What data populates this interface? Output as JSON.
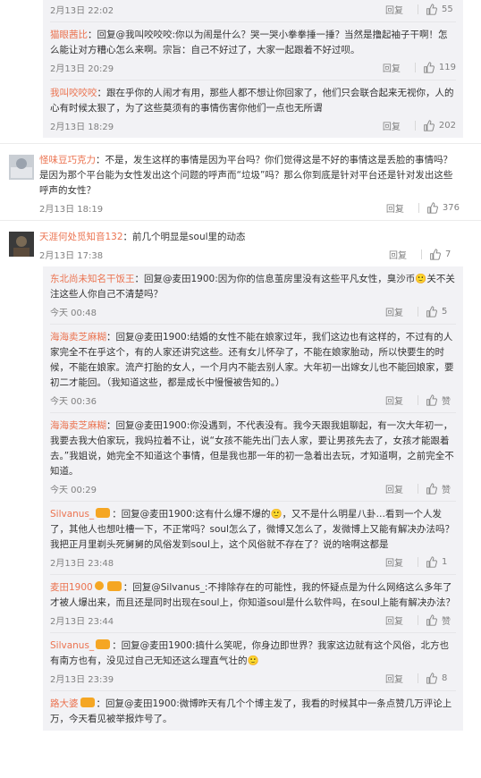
{
  "comments": [
    {
      "kind": "sub",
      "user": "",
      "body": "",
      "time": "2月13日 22:02",
      "reply": "回复",
      "likes": "55"
    },
    {
      "kind": "sub",
      "user": "猫眼茜比",
      "body": "：回复@我叫咬咬咬:你以为闹是什么？哭一哭小拳拳捶一捶？当然是撸起袖子干啊！怎么能让对方糟心怎么来啊。宗旨：自己不好过了，大家一起跟着不好过呗。",
      "time": "2月13日 20:29",
      "reply": "回复",
      "likes": "119"
    },
    {
      "kind": "sub",
      "user": "我叫咬咬咬",
      "body": "：跟在乎你的人闹才有用，那些人都不想让你回家了，他们只会联合起来无视你，人的心有时候太狠了，为了这些莫须有的事情伤害你他们一点也无所谓",
      "time": "2月13日 18:29",
      "reply": "回复",
      "likes": "202"
    },
    {
      "kind": "top",
      "user": "怪味豆巧克力",
      "body": "：不是，发生这样的事情是因为平台吗？你们觉得这是不好的事情这是丢脸的事情吗？是因为那个平台能为女性发出这个问题的呼声而“垃圾”吗？那么你到底是针对平台还是针对发出这些呼声的女性？",
      "time": "2月13日 18:19",
      "reply": "回复",
      "likes": "376"
    },
    {
      "kind": "top",
      "user": "天涯何处觅知音132",
      "body": "：前几个明显是soul里的动态",
      "time": "2月13日 17:38",
      "reply": "回复",
      "likes": "7"
    },
    {
      "kind": "sub",
      "user": "东北尚未知名干饭王",
      "body": "：回复@麦田1900:因为你的信息茧房里没有这些平凡女性，臭沙币🙂关不关注这些人你自己不清楚吗？",
      "time": "今天 00:48",
      "reply": "回复",
      "likes": "5"
    },
    {
      "kind": "sub",
      "user": "海海卖芝麻糊",
      "body": "：回复@麦田1900:结婚的女性不能在娘家过年，我们这边也有这样的，不过有的人家完全不在乎这个，有的人家还讲究这些。还有女儿怀孕了，不能在娘家胎动，所以快要生的时候，不能在娘家。流产打胎的女人，一个月内不能去别人家。大年初一出嫁女儿也不能回娘家，要初二才能回。（我知道这些，都是成长中慢慢被告知的。）",
      "time": "今天 00:36",
      "reply": "回复",
      "likes": "赞"
    },
    {
      "kind": "sub",
      "user": "海海卖芝麻糊",
      "body": "：回复@麦田1900:你没遇到，不代表没有。我今天跟我姐聊起，有一次大年初一，我要去我大伯家玩，我妈拉着不让，说“女孩不能先出门去人家，要让男孩先去了，女孩才能跟着去。”我姐说，她完全不知道这个事情，但是我也那一年的初一急着出去玩，才知道啊，之前完全不知道。",
      "time": "今天 00:29",
      "reply": "回复",
      "likes": "赞"
    },
    {
      "kind": "sub",
      "user": "Silvanus_",
      "body": "：回复@麦田1900:这有什么爆不爆的🙂，又不是什么明星八卦…看到一个人发了，其他人也想吐槽一下，不正常吗？soul怎么了，微博又怎么了，发微博上又能有解决办法吗？我把正月里剃头死舅舅的风俗发到soul上，这个风俗就不存在了？说的啥啊这都是",
      "time": "2月13日 23:48",
      "reply": "回复",
      "likes": "1"
    },
    {
      "kind": "sub",
      "user": "麦田1900",
      "body": "：回复@Silvanus_:不排除存在的可能性，我的怀疑点是为什么网络这么多年了才被人爆出来，而且还是同时出现在soul上，你知道soul是什么软件吗，在soul上能有解决办法？",
      "time": "2月13日 23:44",
      "reply": "回复",
      "likes": "赞"
    },
    {
      "kind": "sub",
      "user": "Silvanus_",
      "body": "：回复@麦田1900:搞什么笑呢，你身边即世界？我家这边就有这个风俗，北方也有南方也有，没见过自己无知还这么理直气壮的🙂",
      "time": "2月13日 23:39",
      "reply": "回复",
      "likes": "8"
    },
    {
      "kind": "sub",
      "user": "路大婆",
      "body": "：回复@麦田1900:微博昨天有几个个博主发了，我看的时候其中一条点赞几万评论上万，今天看见被举报炸号了。",
      "time": "",
      "reply": "回复",
      "likes": ""
    }
  ]
}
